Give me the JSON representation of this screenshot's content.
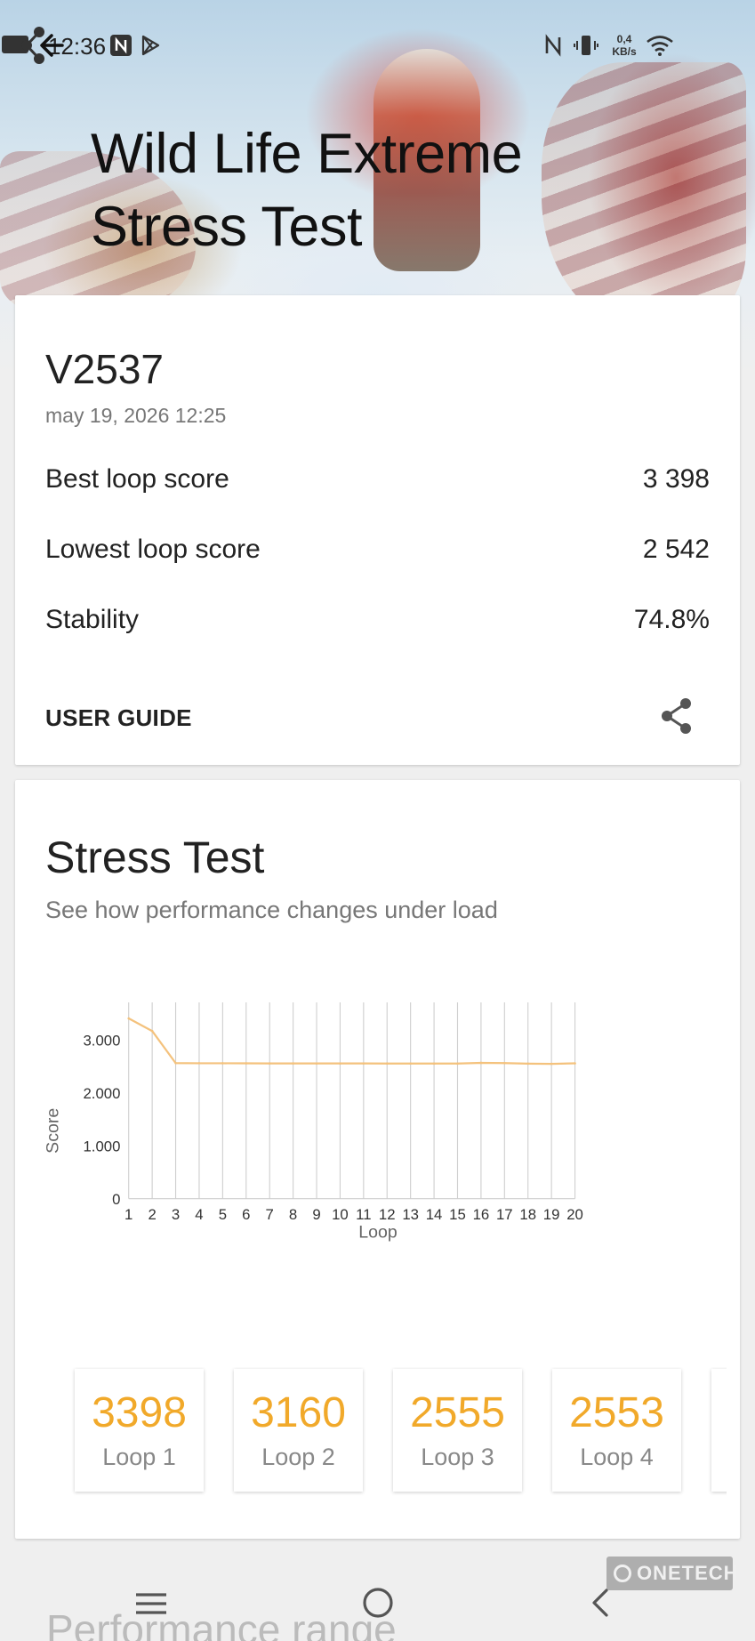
{
  "status_bar": {
    "time": "12:36",
    "network_speed_value": "0,4",
    "network_speed_unit": "KB/s"
  },
  "header": {
    "title_line1": "Wild Life Extreme",
    "title_line2": "Stress Test"
  },
  "result": {
    "device": "V2537",
    "date": "may 19, 2026 12:25",
    "stats": [
      {
        "label": "Best loop score",
        "value": "3 398"
      },
      {
        "label": "Lowest loop score",
        "value": "2 542"
      },
      {
        "label": "Stability",
        "value": "74.8%"
      }
    ],
    "user_guide": "USER GUIDE"
  },
  "stress_test": {
    "title": "Stress Test",
    "subtitle": "See how performance changes under load"
  },
  "chart_data": {
    "type": "line",
    "title": "",
    "xlabel": "Loop",
    "ylabel": "Score",
    "x": [
      1,
      2,
      3,
      4,
      5,
      6,
      7,
      8,
      9,
      10,
      11,
      12,
      13,
      14,
      15,
      16,
      17,
      18,
      19,
      20
    ],
    "series": [
      {
        "values": [
          3398,
          3160,
          2555,
          2553,
          2552,
          2551,
          2550,
          2550,
          2549,
          2549,
          2549,
          2548,
          2547,
          2546,
          2546,
          2560,
          2555,
          2545,
          2542,
          2551
        ]
      }
    ],
    "ylim": [
      0,
      3700
    ],
    "yticks": [
      0,
      1000,
      2000,
      3000
    ],
    "ytick_labels": [
      "0",
      "1.000",
      "2.000",
      "3.000"
    ],
    "grid": "vertical",
    "line_color": "#f4c27d"
  },
  "loops": [
    {
      "score": "3398",
      "label": "Loop 1"
    },
    {
      "score": "3160",
      "label": "Loop 2"
    },
    {
      "score": "2555",
      "label": "Loop 3"
    },
    {
      "score": "2553",
      "label": "Loop 4"
    }
  ],
  "next_section": {
    "title": "Performance range"
  },
  "watermark": "ONETECH",
  "colors": {
    "accent": "#f1a92a",
    "background": "#efefef",
    "card": "#ffffff"
  }
}
